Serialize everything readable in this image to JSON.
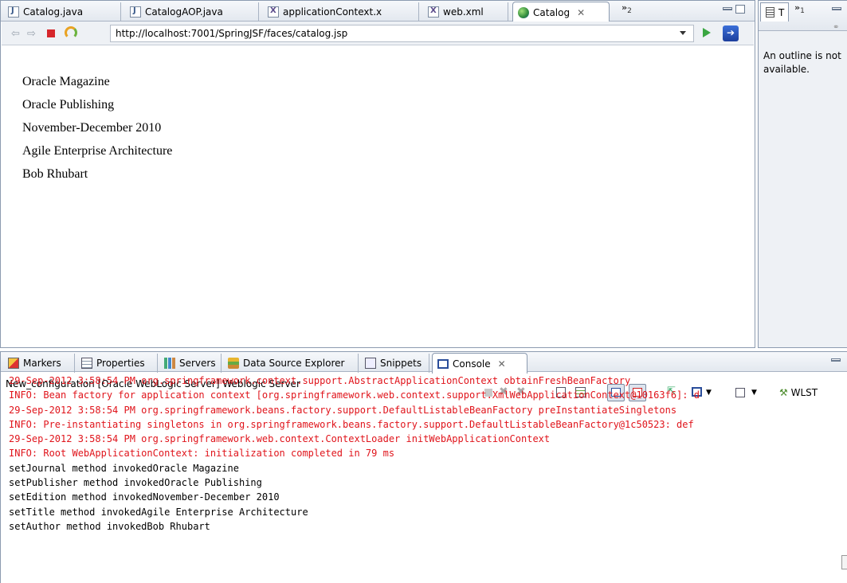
{
  "editor": {
    "tabs": [
      {
        "label": "Catalog.java",
        "icon": "java-file-icon"
      },
      {
        "label": "CatalogAOP.java",
        "icon": "java-file-icon"
      },
      {
        "label": "applicationContext.x",
        "icon": "xml-file-icon"
      },
      {
        "label": "web.xml",
        "icon": "xml-file-icon"
      },
      {
        "label": "Catalog",
        "icon": "globe-icon",
        "active": true
      }
    ],
    "overflow_label": "»",
    "overflow_count": "2"
  },
  "browser": {
    "url": "http://localhost:7001/SpringJSF/faces/catalog.jsp",
    "page_lines": [
      "Oracle Magazine",
      "Oracle Publishing",
      "November-December 2010",
      "Agile Enterprise Architecture",
      "Bob Rhubart"
    ]
  },
  "outline": {
    "tab_label": "T",
    "overflow_label": "»",
    "overflow_count": "1",
    "message_line1": "An outline is not",
    "message_line2": "available."
  },
  "bottom": {
    "tabs": [
      {
        "label": "Markers",
        "icon": "markers-icon"
      },
      {
        "label": "Properties",
        "icon": "properties-icon"
      },
      {
        "label": "Servers",
        "icon": "servers-icon"
      },
      {
        "label": "Data Source Explorer",
        "icon": "data-source-icon"
      },
      {
        "label": "Snippets",
        "icon": "snippets-icon"
      },
      {
        "label": "Console",
        "icon": "console-icon",
        "active": true
      }
    ],
    "console_title": "New_configuration [Oracle WebLogic Server] Weblogic Server",
    "wlst_label": "WLST",
    "lines": [
      {
        "text": "29-Sep-2012 3:58:54 PM org.springframework.context.support.AbstractApplicationContext obtainFreshBeanFactory",
        "type": "err"
      },
      {
        "text": "INFO: Bean factory for application context [org.springframework.web.context.support.XmlWebApplicationContext@10163f6]: d",
        "type": "err"
      },
      {
        "text": "29-Sep-2012 3:58:54 PM org.springframework.beans.factory.support.DefaultListableBeanFactory preInstantiateSingletons",
        "type": "err"
      },
      {
        "text": "INFO: Pre-instantiating singletons in org.springframework.beans.factory.support.DefaultListableBeanFactory@1c50523: def",
        "type": "err"
      },
      {
        "text": "29-Sep-2012 3:58:54 PM org.springframework.web.context.ContextLoader initWebApplicationContext",
        "type": "err"
      },
      {
        "text": "INFO: Root WebApplicationContext: initialization completed in 79 ms",
        "type": "err"
      },
      {
        "text": "setJournal method invokedOracle Magazine",
        "type": "out"
      },
      {
        "text": "setPublisher method invokedOracle Publishing",
        "type": "out"
      },
      {
        "text": "setEdition method invokedNovember-December 2010",
        "type": "out"
      },
      {
        "text": "setTitle method invokedAgile Enterprise Architecture",
        "type": "out"
      },
      {
        "text": "setAuthor method invokedBob Rhubart",
        "type": "out"
      }
    ]
  },
  "colors": {
    "error_text": "#e0141b",
    "active_tab_border": "#8c9bb0",
    "go_arrow": "#3aa642",
    "stop": "#d6262b"
  }
}
